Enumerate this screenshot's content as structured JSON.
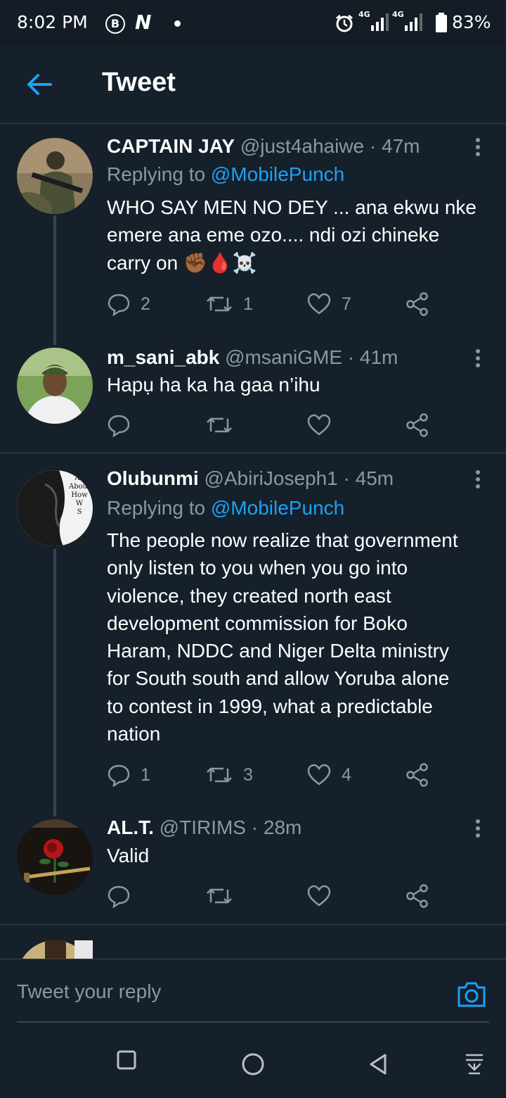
{
  "status_bar": {
    "time": "8:02 PM",
    "b_icon": "B",
    "n_icon": "N",
    "network_1": "4G",
    "network_2": "4G",
    "battery": "83%"
  },
  "header": {
    "title": "Tweet"
  },
  "tweets": [
    {
      "name": "CAPTAIN JAY",
      "handle": "@just4ahaiwe",
      "time": "47m",
      "replying_label": "Replying to",
      "replying_to": "@MobilePunch",
      "lines": [
        "WHO SAY MEN NO DEY ... ana ekwu nke",
        "emere ana eme ozo.... ndi ozi chineke",
        "carry on ✊🏾🩸☠️"
      ],
      "replies": "2",
      "retweets": "1",
      "likes": "7"
    },
    {
      "name": "m_sani_abk",
      "handle": "@msaniGME",
      "time": "41m",
      "lines": [
        "Hapụ ha ka ha gaa n’ihu"
      ],
      "replies": "",
      "retweets": "",
      "likes": ""
    },
    {
      "name": "Olubunmi",
      "handle": "@AbiriJoseph1",
      "time": "45m",
      "replying_label": "Replying to",
      "replying_to": "@MobilePunch",
      "lines": [
        "The people now realize that government",
        "only listen to you when you go into",
        "violence, they created north east",
        "development commission for Boko",
        "Haram, NDDC and Niger Delta ministry",
        "for South south and allow Yoruba alone",
        "to contest in 1999, what a predictable",
        "nation"
      ],
      "replies": "1",
      "retweets": "3",
      "likes": "4",
      "avatar_text": [
        "All",
        "About",
        "How",
        "W",
        "S"
      ]
    },
    {
      "name": "AL.T.",
      "handle": "@TIRIMS",
      "time": "28m",
      "lines": [
        "Valid"
      ],
      "replies": "",
      "retweets": "",
      "likes": ""
    }
  ],
  "composer": {
    "placeholder": "Tweet your reply"
  },
  "icons": {
    "back": "arrow-left-icon",
    "reply": "speech-bubble-icon",
    "retweet": "retweet-icon",
    "like": "heart-icon",
    "share": "share-icon",
    "more": "more-vertical-icon",
    "camera": "camera-icon"
  },
  "colors": {
    "background": "#15202b",
    "accent": "#1da1f2",
    "secondary_text": "#8899a6",
    "divider": "#38444d"
  }
}
